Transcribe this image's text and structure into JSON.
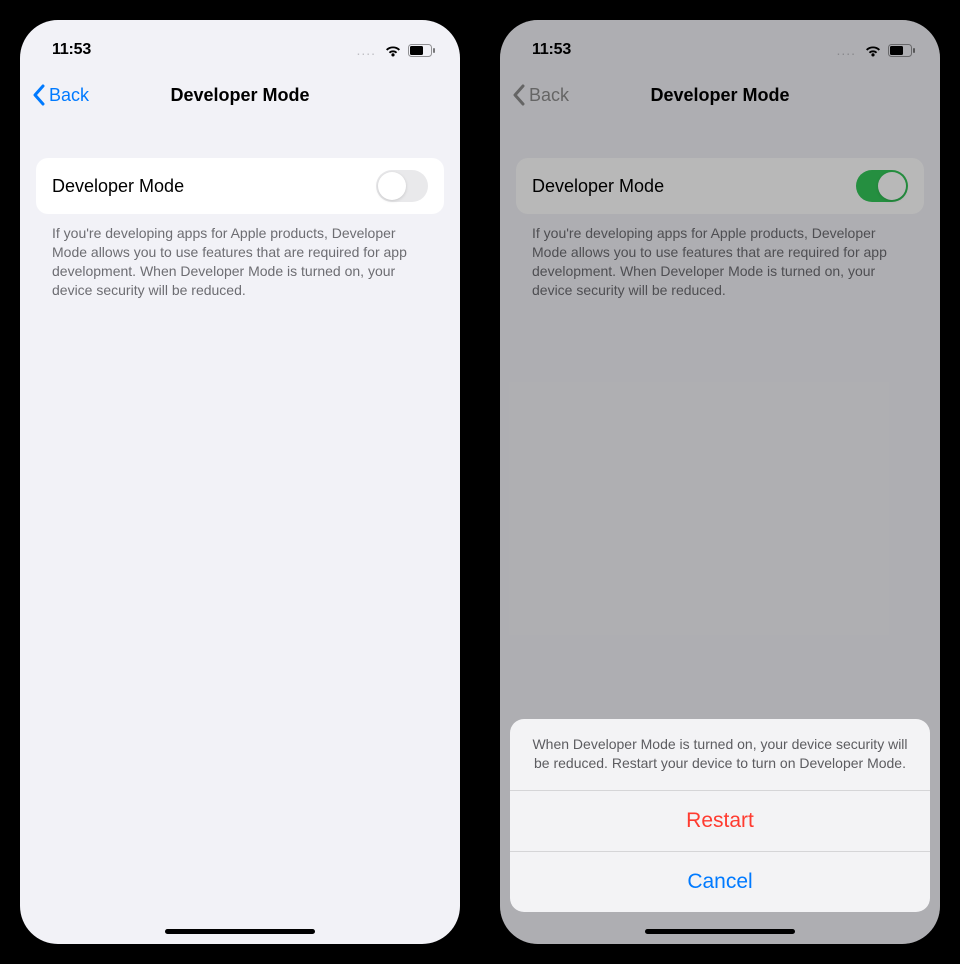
{
  "status": {
    "time": "11:53"
  },
  "nav": {
    "back_label": "Back",
    "title": "Developer Mode"
  },
  "row": {
    "label": "Developer Mode"
  },
  "footer": {
    "text": "If you're developing apps for Apple products, Developer Mode allows you to use features that are required for app development. When Developer Mode is turned on, your device security will be reduced."
  },
  "sheet": {
    "message": "When Developer Mode is turned on, your device security will be reduced. Restart your device to turn on Developer Mode.",
    "restart": "Restart",
    "cancel": "Cancel"
  }
}
